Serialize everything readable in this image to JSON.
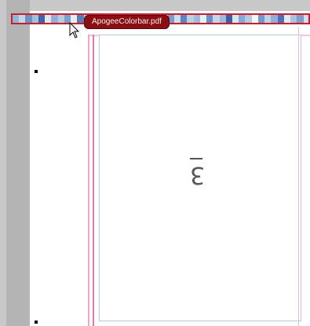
{
  "document": {
    "tab_label": "ApogeeColorbar.pdf",
    "page_label": "3",
    "colorbar_colors": [
      "#8fb7d8",
      "#c9d6e4",
      "#6f8fbf",
      "#a4c1dc",
      "#3f64a8",
      "#dfe7f1",
      "#91b0d6",
      "#b9ccdf",
      "#7a9ecf",
      "#e8eef6",
      "#5a7db8",
      "#c4d4e8",
      "#9ab6d8",
      "#2c4f94",
      "#d7e2ef",
      "#86a8d2",
      "#b1c7e1",
      "#f0f4f9",
      "#6e93c8",
      "#c0d1e6",
      "#98b2d4",
      "#4a6fb0",
      "#e2eaf4",
      "#a7bfdd",
      "#7b9bc9",
      "#d1deec",
      "#5e83bd",
      "#bccfe5",
      "#9fb9da",
      "#e9eff7",
      "#6b8ec4",
      "#c7d6ea",
      "#a0bbd9",
      "#3c5ea0",
      "#d9e4f0",
      "#88a9d1",
      "#b5c9e2",
      "#f3f6fa",
      "#719ac9",
      "#c3d3e7",
      "#93aed3",
      "#4f73b2",
      "#e4ebf4",
      "#abc2dd",
      "#7e9fcc",
      "#d4e0ed"
    ]
  }
}
